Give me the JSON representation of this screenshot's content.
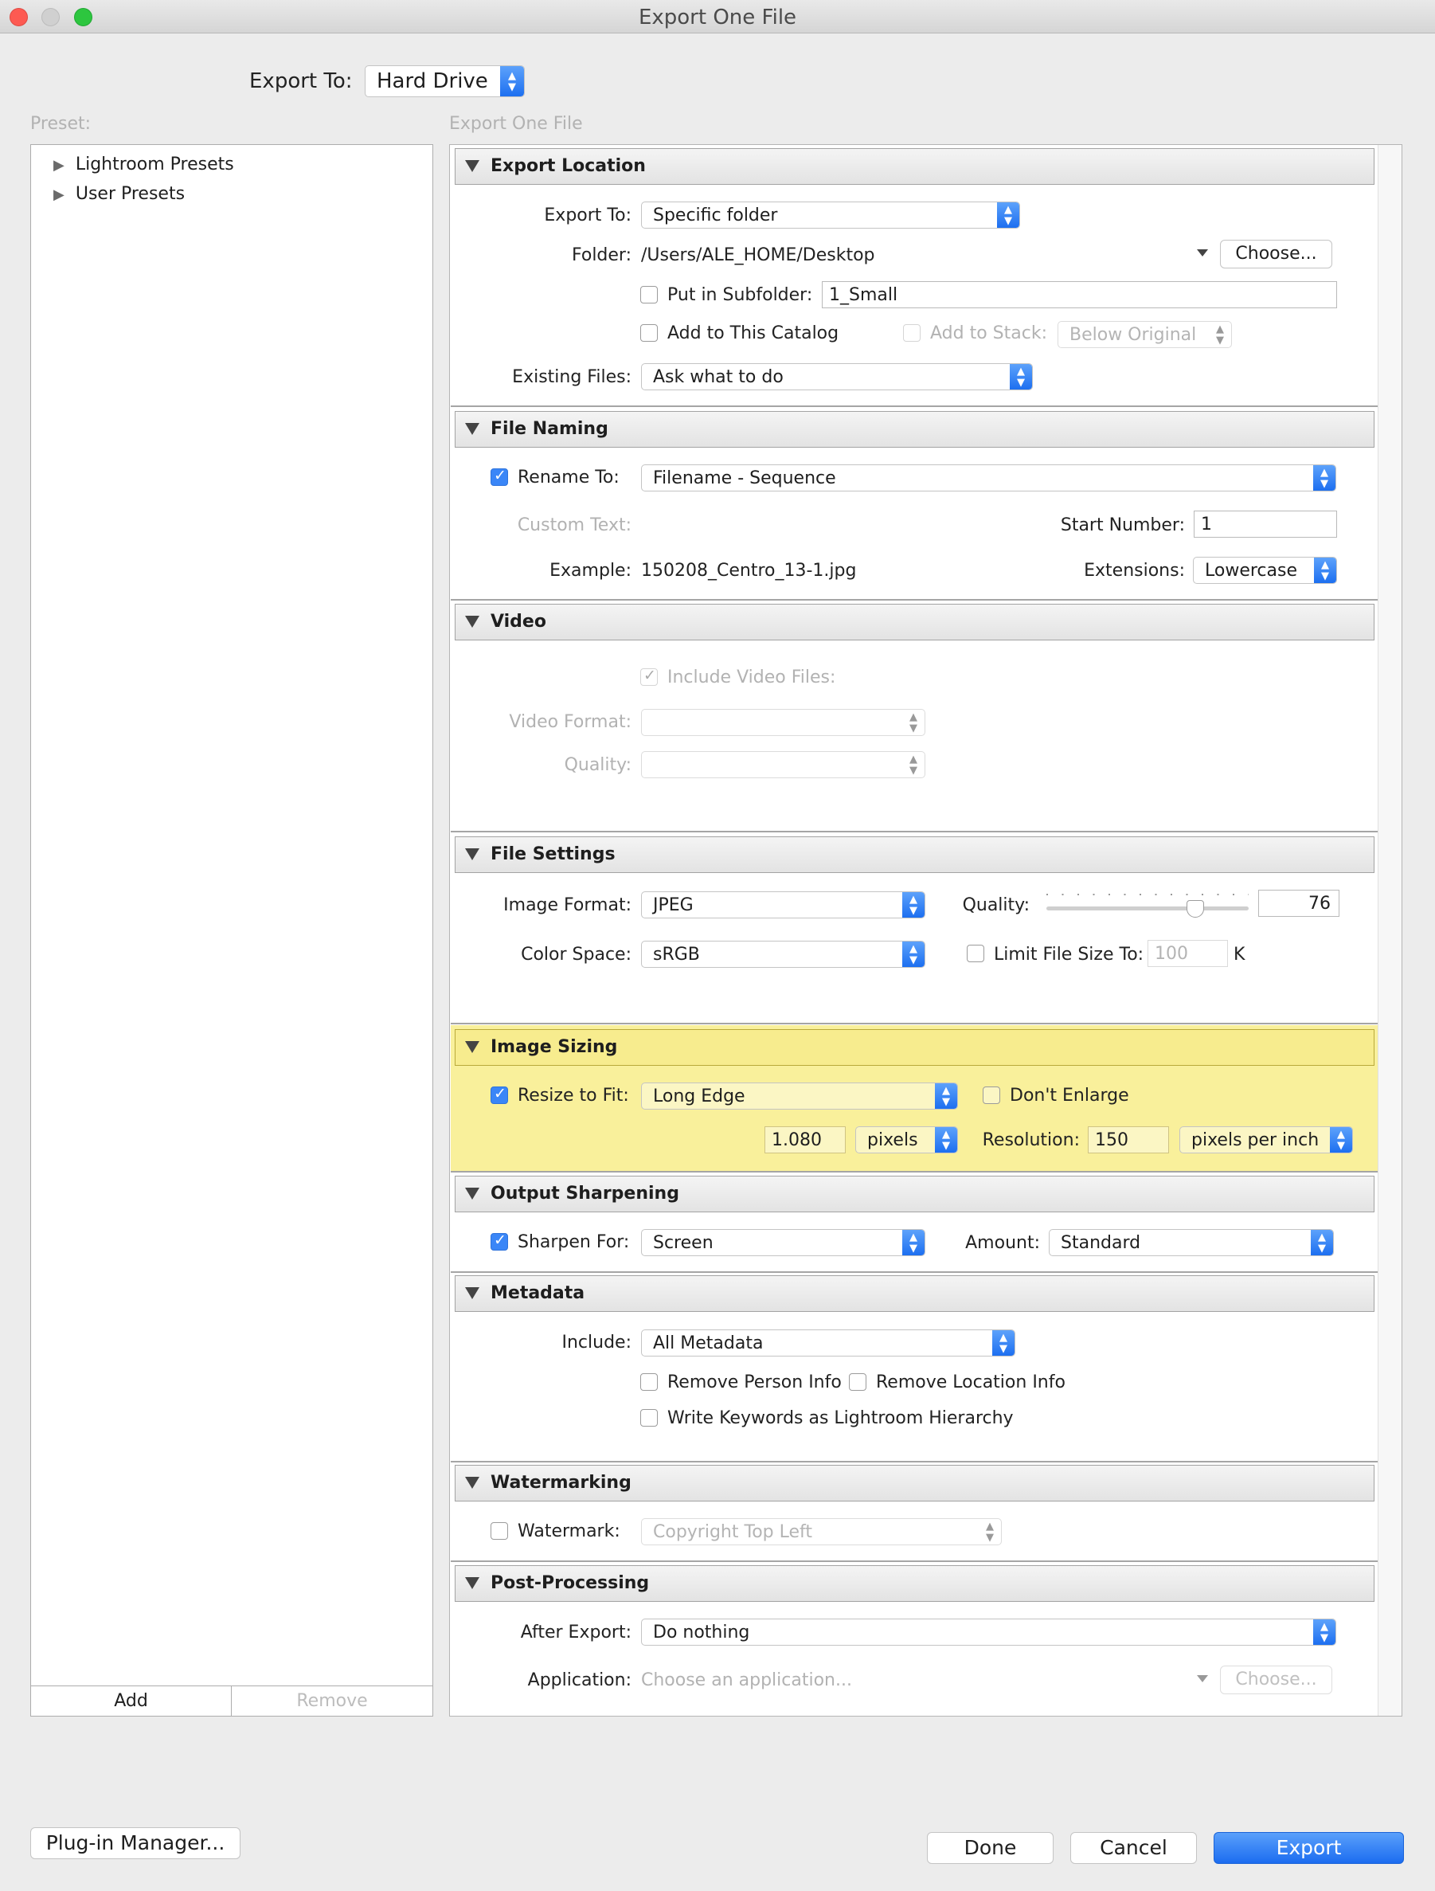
{
  "window": {
    "title": "Export One File"
  },
  "header": {
    "export_to_label": "Export To:",
    "export_to_value": "Hard Drive"
  },
  "preset_panel": {
    "label": "Preset:",
    "items": [
      "Lightroom Presets",
      "User Presets"
    ],
    "add_label": "Add",
    "remove_label": "Remove"
  },
  "settings_title": "Export One File",
  "export_location": {
    "title": "Export Location",
    "export_to_label": "Export To:",
    "export_to_value": "Specific folder",
    "folder_label": "Folder:",
    "folder_value": "/Users/ALE_HOME/Desktop",
    "choose_label": "Choose...",
    "subfolder_label": "Put in Subfolder:",
    "subfolder_value": "1_Small",
    "add_catalog_label": "Add to This Catalog",
    "add_stack_label": "Add to Stack:",
    "stack_value": "Below Original",
    "existing_label": "Existing Files:",
    "existing_value": "Ask what to do"
  },
  "file_naming": {
    "title": "File Naming",
    "rename_label": "Rename To:",
    "rename_value": "Filename - Sequence",
    "custom_text_label": "Custom Text:",
    "start_number_label": "Start Number:",
    "start_number_value": "1",
    "example_label": "Example:",
    "example_value": "150208_Centro_13-1.jpg",
    "extensions_label": "Extensions:",
    "extensions_value": "Lowercase"
  },
  "video": {
    "title": "Video",
    "include_label": "Include Video Files:",
    "format_label": "Video Format:",
    "quality_label": "Quality:"
  },
  "file_settings": {
    "title": "File Settings",
    "format_label": "Image Format:",
    "format_value": "JPEG",
    "quality_label": "Quality:",
    "quality_value": "76",
    "quality_level": 0.76,
    "colorspace_label": "Color Space:",
    "colorspace_value": "sRGB",
    "limit_label": "Limit File Size To:",
    "limit_value": "100",
    "limit_unit": "K"
  },
  "image_sizing": {
    "title": "Image Sizing",
    "resize_label": "Resize to Fit:",
    "resize_value": "Long Edge",
    "dont_enlarge_label": "Don't Enlarge",
    "size_value": "1.080",
    "size_unit": "pixels",
    "resolution_label": "Resolution:",
    "resolution_value": "150",
    "resolution_unit": "pixels per inch"
  },
  "output_sharpening": {
    "title": "Output Sharpening",
    "sharpen_label": "Sharpen For:",
    "sharpen_value": "Screen",
    "amount_label": "Amount:",
    "amount_value": "Standard"
  },
  "metadata": {
    "title": "Metadata",
    "include_label": "Include:",
    "include_value": "All Metadata",
    "remove_person_label": "Remove Person Info",
    "remove_location_label": "Remove Location Info",
    "keywords_label": "Write Keywords as Lightroom Hierarchy"
  },
  "watermarking": {
    "title": "Watermarking",
    "watermark_label": "Watermark:",
    "watermark_value": "Copyright Top Left"
  },
  "post_processing": {
    "title": "Post-Processing",
    "after_label": "After Export:",
    "after_value": "Do nothing",
    "app_label": "Application:",
    "app_placeholder": "Choose an application...",
    "choose_label": "Choose..."
  },
  "footer": {
    "plugin_label": "Plug-in Manager...",
    "done_label": "Done",
    "cancel_label": "Cancel",
    "export_label": "Export"
  },
  "colors": {
    "accent": "#1d6ff0",
    "highlight": "#f7ec8e"
  }
}
